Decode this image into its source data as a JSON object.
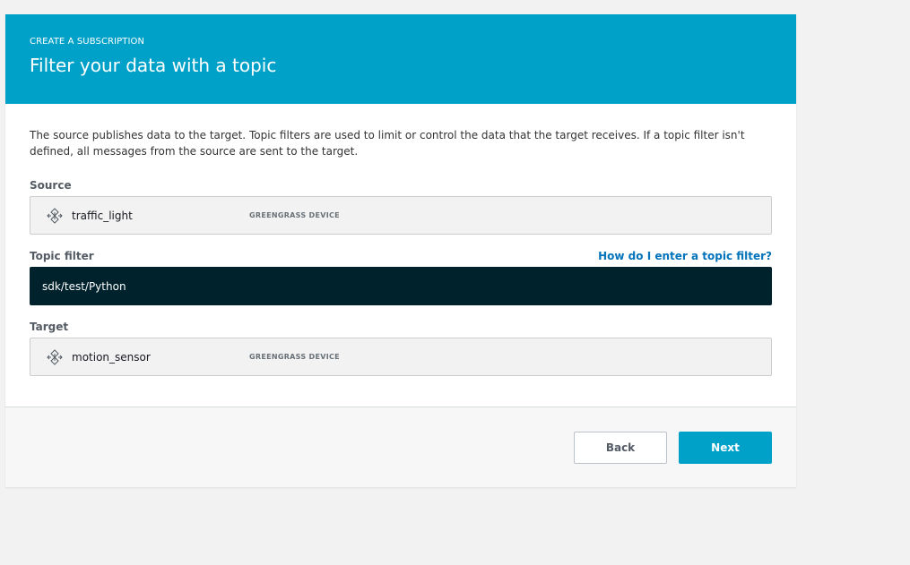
{
  "header": {
    "eyebrow": "CREATE A SUBSCRIPTION",
    "title": "Filter your data with a topic"
  },
  "description": "The source publishes data to the target. Topic filters are used to limit or control the data that the target receives. If a topic filter isn't defined, all messages from the source are sent to the target.",
  "source": {
    "label": "Source",
    "device_name": "traffic_light",
    "device_type": "GREENGRASS DEVICE",
    "icon": "device-icon"
  },
  "topic_filter": {
    "label": "Topic filter",
    "help_link": "How do I enter a topic filter?",
    "value": "sdk/test/Python"
  },
  "target": {
    "label": "Target",
    "device_name": "motion_sensor",
    "device_type": "GREENGRASS DEVICE",
    "icon": "device-icon"
  },
  "footer": {
    "back_label": "Back",
    "next_label": "Next"
  },
  "colors": {
    "accent": "#00a1c9",
    "input_dark": "#00222d",
    "link": "#0073bb"
  }
}
